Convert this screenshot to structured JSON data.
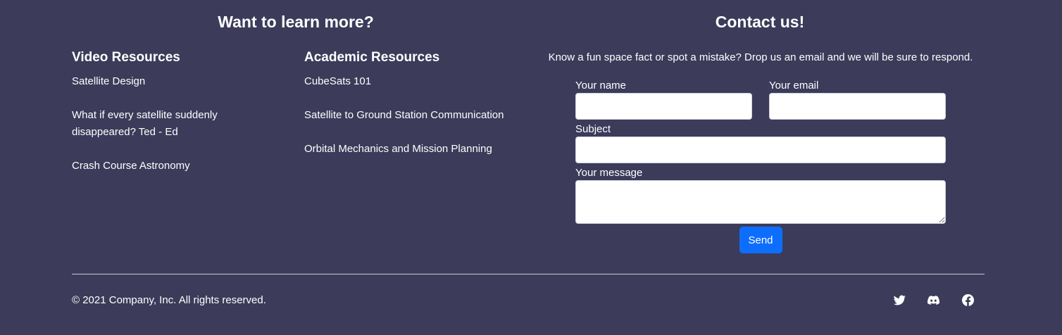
{
  "learn": {
    "title": "Want to learn more?",
    "video": {
      "heading": "Video Resources",
      "items": [
        "Satellite Design",
        "What if every satellite suddenly disappeared? Ted - Ed",
        "Crash Course Astronomy"
      ]
    },
    "academic": {
      "heading": "Academic Resources",
      "items": [
        "CubeSats 101",
        "Satellite to Ground Station Communication",
        "Orbital Mechanics and Mission Planning"
      ]
    }
  },
  "contact": {
    "title": "Contact us!",
    "lead": "Know a fun space fact or spot a mistake? Drop us an email and we will be sure to respond.",
    "name_label": "Your name",
    "name_value": "",
    "email_label": "Your email",
    "email_value": "",
    "subject_label": "Subject",
    "subject_value": "",
    "message_label": "Your message",
    "message_value": "",
    "send_label": "Send"
  },
  "footer": {
    "copyright": "© 2021 Company, Inc. All rights reserved.",
    "social": [
      "twitter-icon",
      "discord-icon",
      "facebook-icon"
    ]
  },
  "colors": {
    "background": "#3c3b5a",
    "accent": "#0d6efd",
    "text": "#ffffff"
  }
}
